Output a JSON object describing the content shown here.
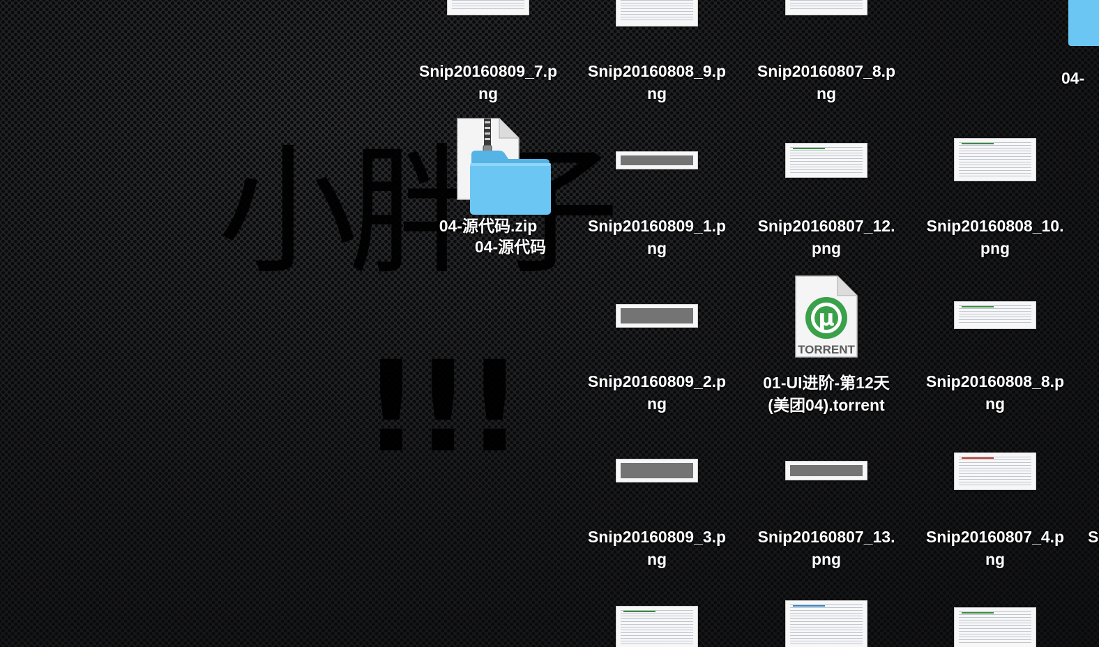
{
  "wallpaper": {
    "main_text": "小胖子",
    "exclaim_text": "!!!"
  },
  "desktop": {
    "items": [
      {
        "kind": "png",
        "line1": "Snip20160809_7.p",
        "line2": "ng"
      },
      {
        "kind": "png",
        "line1": "Snip20160808_9.p",
        "line2": "ng"
      },
      {
        "kind": "png",
        "line1": "Snip20160807_8.p",
        "line2": "ng"
      },
      {
        "kind": "folder",
        "line1": "04-",
        "line2": ""
      },
      {
        "kind": "zip",
        "line1": "04-源代码.zip",
        "line2": ""
      },
      {
        "kind": "folder",
        "line1": "04-源代码",
        "line2": ""
      },
      {
        "kind": "png",
        "line1": "Snip20160809_1.p",
        "line2": "ng"
      },
      {
        "kind": "png",
        "line1": "Snip20160807_12.",
        "line2": "png"
      },
      {
        "kind": "png",
        "line1": "Snip20160808_10.",
        "line2": "png"
      },
      {
        "kind": "png",
        "line1": "Snip20160809_2.p",
        "line2": "ng"
      },
      {
        "kind": "torrent",
        "line1": "01-UI进阶-第12天",
        "line2": "(美团04).torrent",
        "badge": "TORRENT",
        "glyph": "µ"
      },
      {
        "kind": "png",
        "line1": "Snip20160808_8.p",
        "line2": "ng"
      },
      {
        "kind": "png",
        "line1": "Snip20160809_3.p",
        "line2": "ng"
      },
      {
        "kind": "png",
        "line1": "Snip20160807_13.",
        "line2": "png"
      },
      {
        "kind": "png",
        "line1": "Snip20160807_4.p",
        "line2": "ng"
      },
      {
        "kind": "png",
        "line1": "S",
        "line2": ""
      },
      {
        "kind": "png",
        "line1": "",
        "line2": ""
      },
      {
        "kind": "png",
        "line1": "",
        "line2": ""
      },
      {
        "kind": "png",
        "line1": "",
        "line2": ""
      }
    ]
  },
  "colors": {
    "folder_front": "#6cc6f4",
    "folder_back": "#55b3e6",
    "label_text": "#ffffff",
    "torrent_green": "#3aa14a"
  }
}
